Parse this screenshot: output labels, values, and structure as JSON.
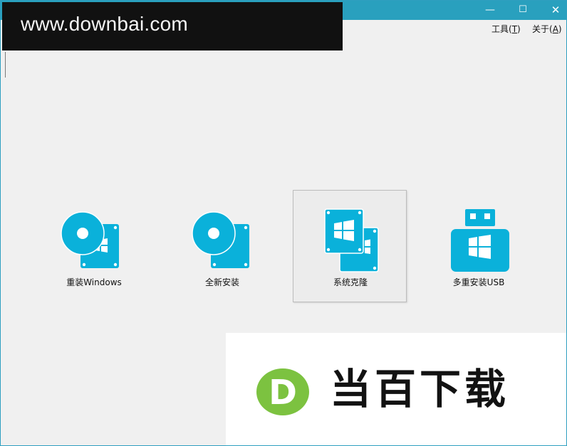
{
  "window": {
    "minimize_glyph": "—",
    "maximize_glyph": "☐",
    "close_glyph": "✕"
  },
  "watermark": {
    "text": "www.downbai.com"
  },
  "menu": {
    "tools": {
      "text": "工具(",
      "key": "T",
      "end": ")"
    },
    "about": {
      "text": "关于(",
      "key": "A",
      "end": ")"
    }
  },
  "actions": [
    {
      "label": "重装Windows",
      "icon": "disc-windows-icon"
    },
    {
      "label": "全新安装",
      "icon": "disc-install-icon"
    },
    {
      "label": "系统克隆",
      "icon": "windows-clone-icon",
      "selected": true
    },
    {
      "label": "多重安装USB",
      "icon": "usb-windows-icon"
    }
  ],
  "brand": {
    "logo_letter": "D",
    "name": "当百下载",
    "accent_color": "#0ab1da",
    "logo_green": "#7cc240",
    "title_bar_color": "#29a0be"
  }
}
